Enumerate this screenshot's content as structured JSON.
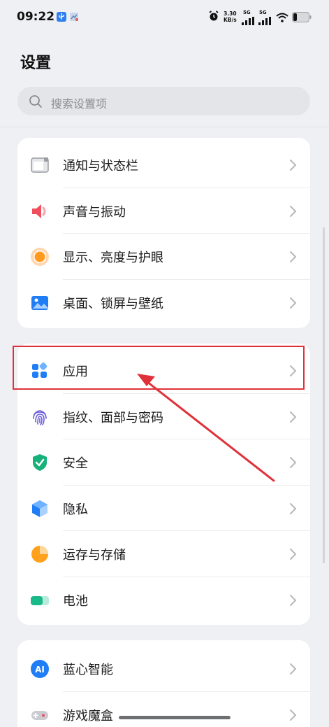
{
  "status_bar": {
    "time": "09:22",
    "net_speed_value": "3.30",
    "net_speed_unit": "KB/s",
    "sim1_label": "5G",
    "sim2_label": "5G"
  },
  "page": {
    "title": "设置"
  },
  "search": {
    "placeholder": "搜索设置项"
  },
  "groups": [
    {
      "items": [
        {
          "label": "通知与状态栏",
          "icon": "notification-bar-icon"
        },
        {
          "label": "声音与振动",
          "icon": "speaker-icon"
        },
        {
          "label": "显示、亮度与护眼",
          "icon": "brightness-icon"
        },
        {
          "label": "桌面、锁屏与壁纸",
          "icon": "wallpaper-icon"
        }
      ]
    },
    {
      "items": [
        {
          "label": "应用",
          "icon": "apps-icon"
        },
        {
          "label": "指纹、面部与密码",
          "icon": "fingerprint-icon"
        },
        {
          "label": "安全",
          "icon": "shield-icon"
        },
        {
          "label": "隐私",
          "icon": "privacy-cube-icon"
        },
        {
          "label": "运存与存储",
          "icon": "storage-pie-icon"
        },
        {
          "label": "电池",
          "icon": "battery-icon"
        }
      ]
    },
    {
      "items": [
        {
          "label": "蓝心智能",
          "icon": "ai-icon"
        },
        {
          "label": "游戏魔盒",
          "icon": "gamepad-icon"
        }
      ]
    }
  ],
  "colors": {
    "background": "#eff0f3",
    "card": "#ffffff",
    "annotation_red": "#e0313a",
    "accent_blue": "#1f7ef5"
  }
}
